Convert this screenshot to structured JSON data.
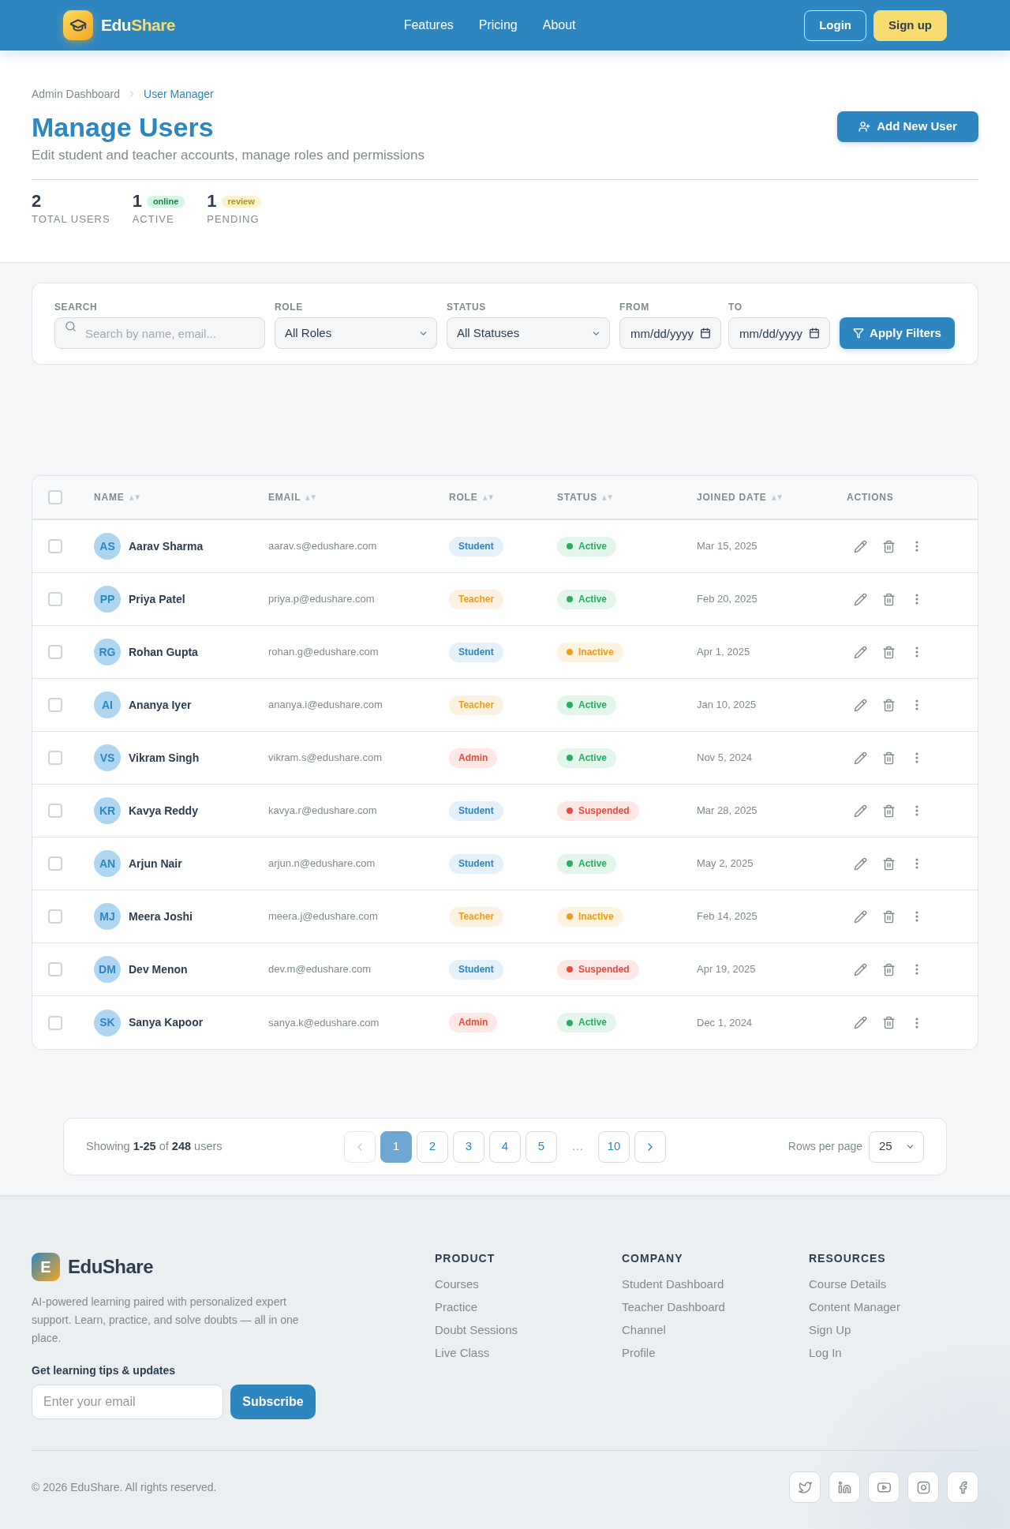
{
  "navbar": {
    "brand": {
      "text": "Edu",
      "accent": "Share"
    },
    "links": [
      "Features",
      "Pricing",
      "About"
    ],
    "buttons": [
      {
        "label": "Login",
        "kind": "outline"
      },
      {
        "label": "Sign up",
        "kind": "filled"
      }
    ]
  },
  "breadcrumb": [
    {
      "label": "Admin Dashboard",
      "selected": false
    },
    {
      "label": "User Manager",
      "selected": true
    }
  ],
  "page_header": {
    "title": "Manage Users",
    "subtitle": "Edit student and teacher accounts, manage roles and permissions",
    "add_button": "Add New User"
  },
  "stats": [
    {
      "value": "2",
      "label": "TOTAL USERS"
    },
    {
      "value": "1",
      "badge": {
        "label": "online",
        "kind": "success"
      },
      "label": "ACTIVE"
    },
    {
      "value": "1",
      "badge": {
        "label": "review",
        "kind": "warning"
      },
      "label": "PENDING"
    }
  ],
  "filters": {
    "search": {
      "label": "SEARCH",
      "placeholder": "Search by name, email..."
    },
    "selects": [
      {
        "label": "ROLE",
        "value": "All Roles"
      },
      {
        "label": "STATUS",
        "value": "All Statuses"
      }
    ],
    "dates": [
      {
        "label": "FROM",
        "placeholder": "mm/dd/yyyy"
      },
      {
        "label": "TO",
        "placeholder": "mm/dd/yyyy"
      }
    ],
    "apply_button": "Apply Filters"
  },
  "table": {
    "select_all": {
      "checked": false
    },
    "columns": [
      {
        "label": "NAME",
        "sortable": true
      },
      {
        "label": "EMAIL",
        "sortable": true
      },
      {
        "label": "ROLE",
        "sortable": true
      },
      {
        "label": "STATUS",
        "sortable": true
      },
      {
        "label": "JOINED DATE",
        "sortable": true
      },
      {
        "label": "ACTIONS",
        "sortable": false
      }
    ],
    "rows": [
      {
        "checked": false,
        "initials": "AS",
        "name": "Aarav Sharma",
        "email": "aarav.s@edushare.com",
        "role": {
          "label": "Student",
          "kind": "student"
        },
        "status": {
          "label": "Active",
          "kind": "active"
        },
        "joined": "Mar 15, 2025"
      },
      {
        "checked": false,
        "initials": "PP",
        "name": "Priya Patel",
        "email": "priya.p@edushare.com",
        "role": {
          "label": "Teacher",
          "kind": "teacher"
        },
        "status": {
          "label": "Active",
          "kind": "active"
        },
        "joined": "Feb 20, 2025"
      },
      {
        "checked": false,
        "initials": "RG",
        "name": "Rohan Gupta",
        "email": "rohan.g@edushare.com",
        "role": {
          "label": "Student",
          "kind": "student"
        },
        "status": {
          "label": "Inactive",
          "kind": "inactive"
        },
        "joined": "Apr 1, 2025"
      },
      {
        "checked": false,
        "initials": "AI",
        "name": "Ananya Iyer",
        "email": "ananya.i@edushare.com",
        "role": {
          "label": "Teacher",
          "kind": "teacher"
        },
        "status": {
          "label": "Active",
          "kind": "active"
        },
        "joined": "Jan 10, 2025"
      },
      {
        "checked": false,
        "initials": "VS",
        "name": "Vikram Singh",
        "email": "vikram.s@edushare.com",
        "role": {
          "label": "Admin",
          "kind": "admin"
        },
        "status": {
          "label": "Active",
          "kind": "active"
        },
        "joined": "Nov 5, 2024"
      },
      {
        "checked": false,
        "initials": "KR",
        "name": "Kavya Reddy",
        "email": "kavya.r@edushare.com",
        "role": {
          "label": "Student",
          "kind": "student"
        },
        "status": {
          "label": "Suspended",
          "kind": "suspended"
        },
        "joined": "Mar 28, 2025"
      },
      {
        "checked": false,
        "initials": "AN",
        "name": "Arjun Nair",
        "email": "arjun.n@edushare.com",
        "role": {
          "label": "Student",
          "kind": "student"
        },
        "status": {
          "label": "Active",
          "kind": "active"
        },
        "joined": "May 2, 2025"
      },
      {
        "checked": false,
        "initials": "MJ",
        "name": "Meera Joshi",
        "email": "meera.j@edushare.com",
        "role": {
          "label": "Teacher",
          "kind": "teacher"
        },
        "status": {
          "label": "Inactive",
          "kind": "inactive"
        },
        "joined": "Feb 14, 2025"
      },
      {
        "checked": false,
        "initials": "DM",
        "name": "Dev Menon",
        "email": "dev.m@edushare.com",
        "role": {
          "label": "Student",
          "kind": "student"
        },
        "status": {
          "label": "Suspended",
          "kind": "suspended"
        },
        "joined": "Apr 19, 2025"
      },
      {
        "checked": false,
        "initials": "SK",
        "name": "Sanya Kapoor",
        "email": "sanya.k@edushare.com",
        "role": {
          "label": "Admin",
          "kind": "admin"
        },
        "status": {
          "label": "Active",
          "kind": "active"
        },
        "joined": "Dec 1, 2024"
      }
    ]
  },
  "pagination": {
    "summary": "Showing **1-25** of **248** users",
    "prev": {
      "disabled": true
    },
    "pages": [
      {
        "label": "1",
        "kind": "page",
        "selected": true
      },
      {
        "label": "2",
        "kind": "page",
        "selected": false
      },
      {
        "label": "3",
        "kind": "page",
        "selected": false
      },
      {
        "label": "4",
        "kind": "page",
        "selected": false
      },
      {
        "label": "5",
        "kind": "page",
        "selected": false
      },
      {
        "label": "…",
        "kind": "ellipsis",
        "selected": false
      },
      {
        "label": "10",
        "kind": "page",
        "selected": false
      }
    ],
    "next": {
      "disabled": false
    },
    "rows_per_page": {
      "label": "Rows per page",
      "value": "25"
    }
  },
  "footer": {
    "brand": {
      "mark": "E",
      "name": "EduShare"
    },
    "description": "AI-powered learning paired with personalized expert support. Learn, practice, and solve doubts — all in one place.",
    "newsletter": {
      "heading": "Get learning tips & updates",
      "placeholder": "Enter your email",
      "button": "Subscribe"
    },
    "columns": [
      {
        "heading": "PRODUCT",
        "links": [
          "Courses",
          "Practice",
          "Doubt Sessions",
          "Live Class"
        ]
      },
      {
        "heading": "COMPANY",
        "links": [
          "Student Dashboard",
          "Teacher Dashboard",
          "Channel",
          "Profile"
        ]
      },
      {
        "heading": "RESOURCES",
        "links": [
          "Course Details",
          "Content Manager",
          "Sign Up",
          "Log In"
        ]
      }
    ],
    "copyright": "© 2026 EduShare. All rights reserved.",
    "social": [
      {
        "kind": "twitter"
      },
      {
        "kind": "linkedin"
      },
      {
        "kind": "youtube"
      },
      {
        "kind": "instagram"
      },
      {
        "kind": "facebook"
      }
    ]
  }
}
